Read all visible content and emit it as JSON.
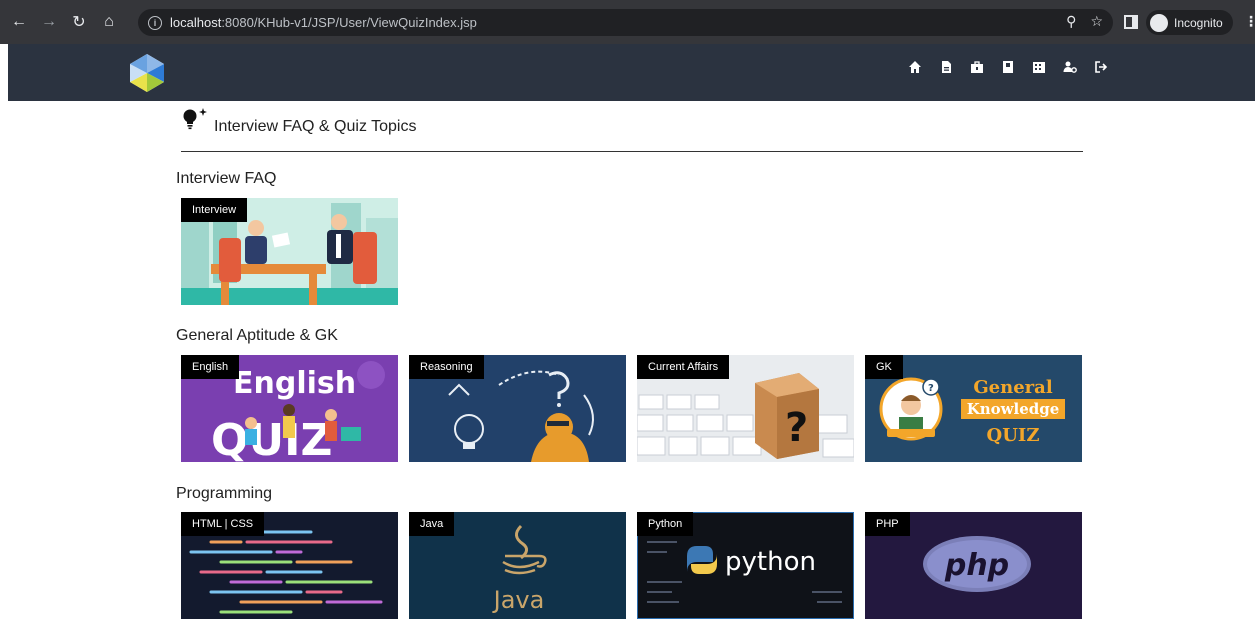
{
  "browser": {
    "url_host": "localhost",
    "url_rest": ":8080/KHub-v1/JSP/User/ViewQuizIndex.jsp",
    "incognito_label": "Incognito"
  },
  "page": {
    "heading": "Interview FAQ & Quiz Topics"
  },
  "sections": [
    {
      "title": "Interview FAQ",
      "cards": [
        {
          "label": "Interview"
        }
      ]
    },
    {
      "title": "General Aptitude & GK",
      "cards": [
        {
          "label": "English",
          "art_text": [
            "English",
            "QUIZ"
          ]
        },
        {
          "label": "Reasoning"
        },
        {
          "label": "Current Affairs"
        },
        {
          "label": "GK",
          "art_text": [
            "General",
            "Knowledge",
            "QUIZ"
          ]
        }
      ]
    },
    {
      "title": "Programming",
      "cards": [
        {
          "label": "HTML | CSS"
        },
        {
          "label": "Java",
          "art_text": [
            "Java"
          ]
        },
        {
          "label": "Python",
          "art_text": [
            "python"
          ]
        },
        {
          "label": "PHP",
          "art_text": [
            "php"
          ]
        }
      ]
    }
  ],
  "nav_icons": [
    "home-icon",
    "document-icon",
    "briefcase-icon",
    "book-icon",
    "building-icon",
    "users-gear-icon",
    "logout-icon"
  ],
  "colors": {
    "header_bg": "#2b3340",
    "chrome_bg": "#35363a"
  }
}
